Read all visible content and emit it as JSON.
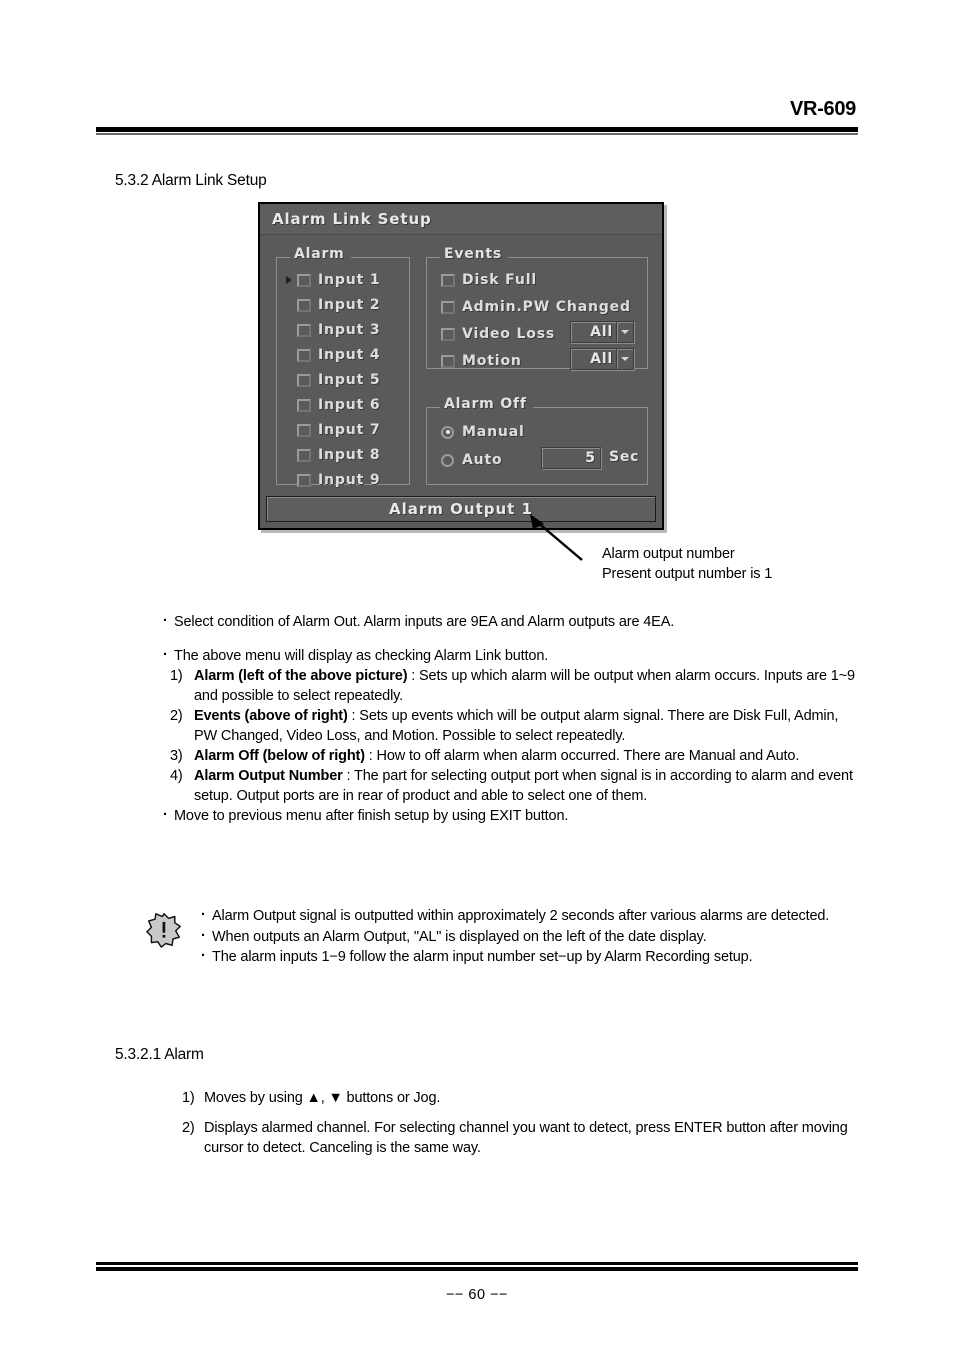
{
  "header": {
    "model": "VR-609"
  },
  "headings": {
    "section_532": "5.3.2 Alarm Link Setup",
    "section_5321": "5.3.2.1 Alarm"
  },
  "dialog": {
    "title": "Alarm Link Setup",
    "alarm_group": {
      "legend": "Alarm",
      "items": [
        {
          "label": "Input 1",
          "checked": false,
          "cursor": true
        },
        {
          "label": "Input 2",
          "checked": false,
          "cursor": false
        },
        {
          "label": "Input 3",
          "checked": false,
          "cursor": false
        },
        {
          "label": "Input 4",
          "checked": false,
          "cursor": false
        },
        {
          "label": "Input 5",
          "checked": false,
          "cursor": false
        },
        {
          "label": "Input 6",
          "checked": false,
          "cursor": false
        },
        {
          "label": "Input 7",
          "checked": false,
          "cursor": false
        },
        {
          "label": "Input 8",
          "checked": false,
          "cursor": false
        },
        {
          "label": "Input 9",
          "checked": false,
          "cursor": false
        }
      ]
    },
    "events_group": {
      "legend": "Events",
      "items": [
        {
          "label": "Disk Full",
          "checked": false
        },
        {
          "label": "Admin.PW Changed",
          "checked": false
        },
        {
          "label": "Video Loss",
          "checked": false,
          "combo": "All"
        },
        {
          "label": "Motion",
          "checked": false,
          "combo": "All"
        }
      ]
    },
    "alarm_off_group": {
      "legend": "Alarm Off",
      "manual_label": "Manual",
      "manual_selected": true,
      "auto_label": "Auto",
      "auto_selected": false,
      "auto_seconds": "5",
      "seconds_unit": "Sec"
    },
    "output_bar": "Alarm Output 1"
  },
  "callout": {
    "line1": "Alarm output number",
    "line2": "Present output number is 1"
  },
  "body": {
    "b1": "Select condition of Alarm Out. Alarm inputs are 9EA and Alarm outputs are 4EA.",
    "b2": "The above menu will display as checking Alarm Link button.",
    "i1_num": "1)",
    "i1_term": "Alarm (left of the above picture)",
    "i1_text": " : Sets up which alarm will be output when alarm occurs. Inputs are 1~9 and possible to select repeatedly.",
    "i2_num": "2)",
    "i2_term": "Events (above of right)",
    "i2_text": " : Sets up events which will be output alarm signal. There are Disk Full, Admin, PW Changed, Video Loss, and Motion. Possible to select repeatedly.",
    "i3_num": "3)",
    "i3_term": "Alarm Off (below of right)",
    "i3_text": " : How to off alarm when alarm occurred. There are Manual and Auto.",
    "i4_num": "4)",
    "i4_term": "Alarm Output Number",
    "i4_text": " : The part for selecting output port when signal is in according to alarm and event setup. Output ports are in rear of product and able to select one of them.",
    "b3": "Move to previous menu after finish setup by using EXIT button."
  },
  "note": {
    "n1": "Alarm Output signal is outputted within approximately 2 seconds after various alarms are detected.",
    "n2": "When outputs an Alarm Output, \"AL\" is displayed on the left of the date display.",
    "n3": "The alarm inputs 1−9 follow the alarm input number set−up by Alarm Recording setup."
  },
  "sub_items": {
    "s1_num": "1)",
    "s1_text": "Moves by using ▲, ▼ buttons or Jog.",
    "s2_num": "2)",
    "s2_text": "Displays alarmed channel. For selecting channel you want to detect, press ENTER button after moving cursor to detect. Canceling is the same way."
  },
  "footer": {
    "page_number": "−− 60 −−"
  }
}
